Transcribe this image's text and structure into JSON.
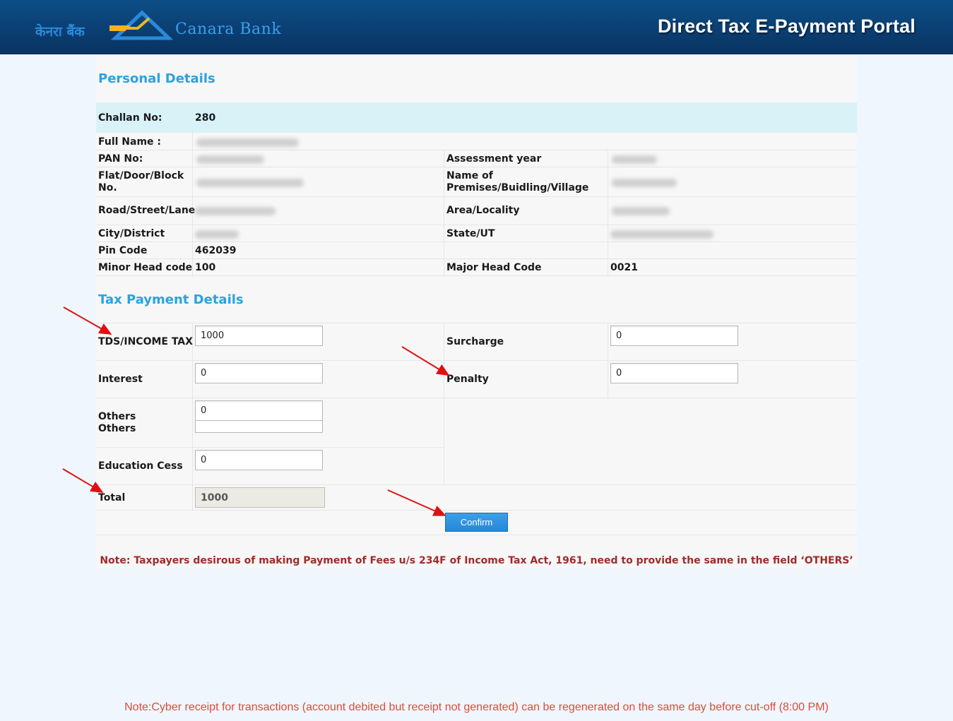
{
  "header": {
    "logo_hindi": "केनरा बैंक",
    "logo_name": "Canara Bank",
    "portal_title": "Direct Tax E-Payment Portal"
  },
  "personal": {
    "section_title": "Personal Details",
    "challan_label": "Challan No:",
    "challan_value": "280",
    "full_name_label": "Full Name :",
    "pan_label": "PAN No:",
    "assessment_year_label": "Assessment year",
    "flat_label_1": "Flat/Door/Block",
    "flat_label_2": "No.",
    "premises_label_1": "Name of",
    "premises_label_2": "Premises/Buidling/Village",
    "road_label": "Road/Street/Lane",
    "area_label": "Area/Locality",
    "city_label": "City/District",
    "state_label": "State/UT",
    "pin_label": "Pin Code",
    "pin_value": "462039",
    "minor_head_label": "Minor Head code",
    "minor_head_value": "100",
    "major_head_label": "Major Head Code",
    "major_head_value": "0021"
  },
  "tax": {
    "section_title": "Tax Payment Details",
    "tds_label": "TDS/INCOME TAX",
    "tds_value": "1000",
    "surcharge_label": "Surcharge",
    "surcharge_value": "0",
    "interest_label": "Interest",
    "interest_value": "0",
    "penalty_label": "Penalty",
    "penalty_value": "0",
    "others_label_1": "Others",
    "others_label_2": "Others",
    "others_value": "0",
    "cess_label": "Education Cess",
    "cess_value": "0",
    "total_label": "Total",
    "total_value": "1000",
    "confirm_label": "Confirm"
  },
  "notes": {
    "fees_note": "Note: Taxpayers desirous of making Payment of Fees u/s 234F of Income Tax Act, 1961, need to provide the same in the field ‘OTHERS’",
    "receipt_note": "Note:Cyber receipt for transactions (account debited but receipt not generated) can be regenerated on the same day before cut-off (8:00 PM)"
  },
  "colors": {
    "header_bg": "#0b3f73",
    "section_title": "#29a3e0",
    "challan_row_bg": "#d8f2f8",
    "annotation_arrow": "#e01010",
    "note_fees": "#a12a2a",
    "note_receipt": "#e04a3a"
  }
}
